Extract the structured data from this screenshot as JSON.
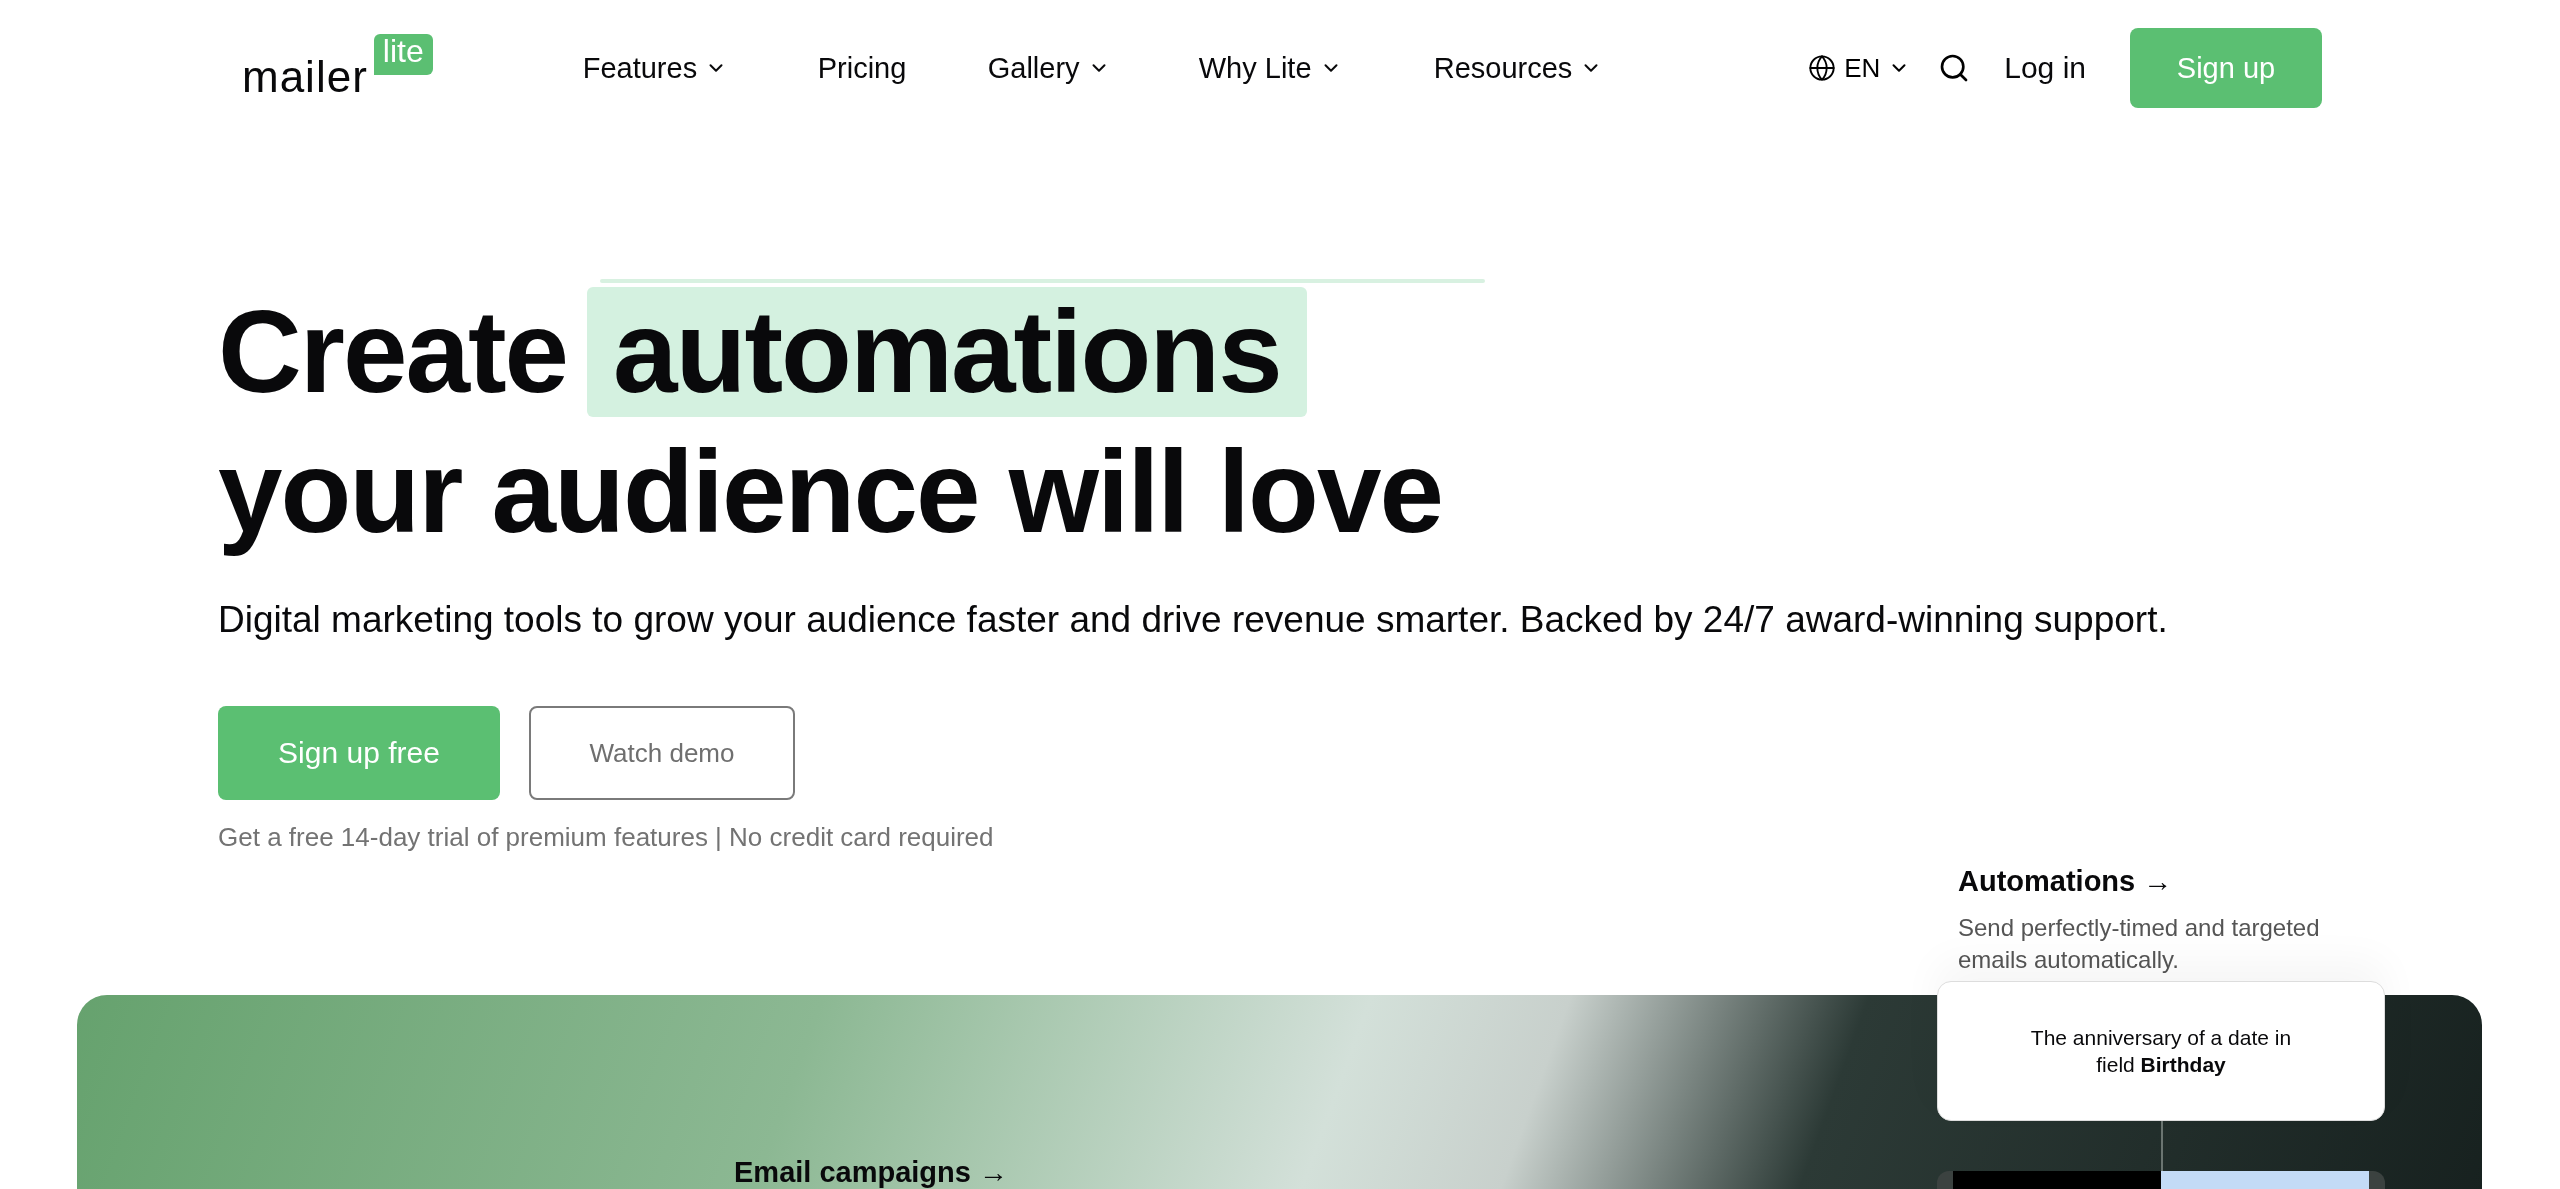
{
  "logo": {
    "word": "mailer",
    "badge": "lite"
  },
  "nav": [
    {
      "label": "Features",
      "dropdown": true
    },
    {
      "label": "Pricing",
      "dropdown": false
    },
    {
      "label": "Gallery",
      "dropdown": true
    },
    {
      "label": "Why Lite",
      "dropdown": true
    },
    {
      "label": "Resources",
      "dropdown": true
    }
  ],
  "language": "EN",
  "login": "Log in",
  "signup": "Sign up",
  "headline": {
    "before": "Create",
    "highlight": "automations",
    "line2": "your audience will love"
  },
  "subtitle": "Digital marketing tools to grow your audience faster and drive revenue smarter. Backed by 24/7 award-winning support.",
  "cta": {
    "primary": "Sign up free",
    "secondary": "Watch demo"
  },
  "note": "Get a free 14-day trial of premium features | No credit card required",
  "feature": {
    "title": "Automations →",
    "description": "Send perfectly-timed and targeted emails automatically."
  },
  "trigger_card": "The anniversary of a date in field **Birthday**",
  "panel_link": "Email campaigns →"
}
